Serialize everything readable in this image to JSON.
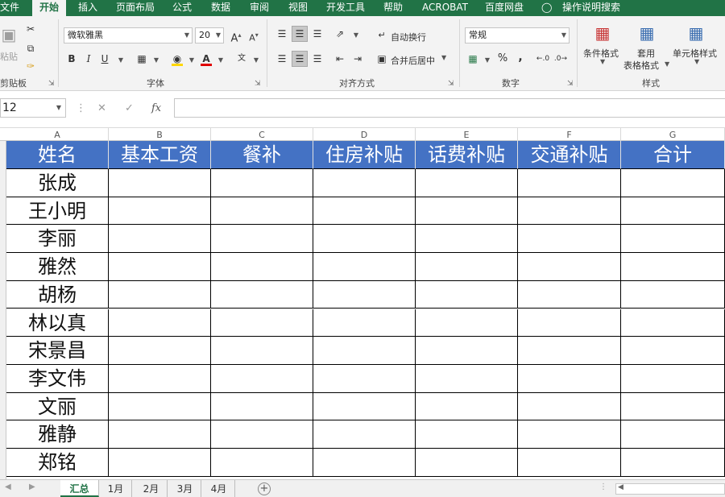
{
  "ribbon": {
    "tabs": [
      "文件",
      "开始",
      "插入",
      "页面布局",
      "公式",
      "数据",
      "审阅",
      "视图",
      "开发工具",
      "帮助",
      "ACROBAT",
      "百度网盘",
      "操作说明搜索"
    ],
    "active_tab": "开始",
    "clipboard": {
      "paste_label": "粘贴",
      "group_label": "剪贴板"
    },
    "font": {
      "name": "微软雅黑",
      "size": "20",
      "bold": "B",
      "italic": "I",
      "underline": "U",
      "group_label": "字体"
    },
    "alignment": {
      "wrap_text": "自动换行",
      "merge_center": "合并后居中",
      "group_label": "对齐方式"
    },
    "number": {
      "format": "常规",
      "percent": "%",
      "comma": ",",
      "group_label": "数字"
    },
    "styles": {
      "conditional_formatting": "条件格式",
      "format_as_table_1": "套用",
      "format_as_table_2": "表格格式",
      "cell_styles": "单元格样式",
      "group_label": "样式"
    }
  },
  "formula_bar": {
    "name_box": "12",
    "fx": "fx",
    "value": ""
  },
  "sheet": {
    "columns": [
      "A",
      "B",
      "C",
      "D",
      "E",
      "F",
      "G"
    ],
    "headers": [
      "姓名",
      "基本工资",
      "餐补",
      "住房补贴",
      "话费补贴",
      "交通补贴",
      "合计"
    ],
    "rows": [
      [
        "张成",
        "",
        "",
        "",
        "",
        "",
        ""
      ],
      [
        "王小明",
        "",
        "",
        "",
        "",
        "",
        ""
      ],
      [
        "李丽",
        "",
        "",
        "",
        "",
        "",
        ""
      ],
      [
        "雅然",
        "",
        "",
        "",
        "",
        "",
        ""
      ],
      [
        "胡杨",
        "",
        "",
        "",
        "",
        "",
        ""
      ],
      [
        "林以真",
        "",
        "",
        "",
        "",
        "",
        ""
      ],
      [
        "宋景昌",
        "",
        "",
        "",
        "",
        "",
        ""
      ],
      [
        "李文伟",
        "",
        "",
        "",
        "",
        "",
        ""
      ],
      [
        "文丽",
        "",
        "",
        "",
        "",
        "",
        ""
      ],
      [
        "雅静",
        "",
        "",
        "",
        "",
        "",
        ""
      ],
      [
        "郑铭",
        "",
        "",
        "",
        "",
        "",
        ""
      ]
    ]
  },
  "sheet_tabs": {
    "tabs": [
      "汇总",
      "1月",
      "2月",
      "3月",
      "4月"
    ],
    "active": "汇总",
    "add_symbol": "+"
  },
  "colors": {
    "accent": "#217346",
    "header_fill": "#4472c4",
    "header_text": "#ffffff"
  }
}
